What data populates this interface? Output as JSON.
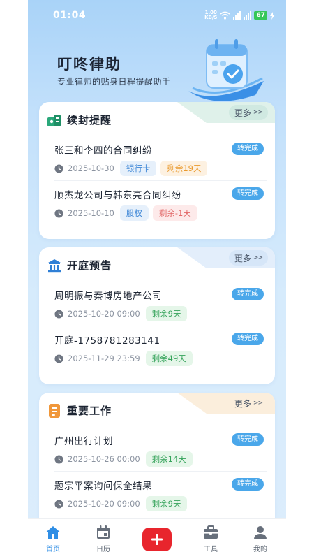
{
  "status_bar": {
    "time": "01:04",
    "net_speed_value": "1.00",
    "net_speed_unit": "KB/S",
    "battery": "67"
  },
  "header": {
    "title": "叮咚律助",
    "subtitle": "专业律师的贴身日程提醒助手"
  },
  "sections": [
    {
      "title": "续封提醒",
      "more_label": "更多",
      "more_arrow": ">>",
      "items": [
        {
          "title": "张三和李四的合同纠纷",
          "date": "2025-10-30",
          "tags": [
            "银行卡",
            "剩余19天"
          ],
          "action": "转完成"
        },
        {
          "title": "顺杰龙公司与韩东亮合同纠纷",
          "date": "2025-10-10",
          "tags": [
            "股权",
            "剩余-1天"
          ],
          "action": "转完成"
        }
      ]
    },
    {
      "title": "开庭预告",
      "more_label": "更多",
      "more_arrow": ">>",
      "items": [
        {
          "title": "周明振与秦博房地产公司",
          "date": "2025-10-20 09:00",
          "tags": [
            "剩余9天"
          ],
          "action": "转完成"
        },
        {
          "title": "开庭-1758781283141",
          "date": "2025-11-29 23:59",
          "tags": [
            "剩余49天"
          ],
          "action": "转完成"
        }
      ]
    },
    {
      "title": "重要工作",
      "more_label": "更多",
      "more_arrow": ">>",
      "items": [
        {
          "title": "广州出行计划",
          "date": "2025-10-26 00:00",
          "tags": [
            "剩余14天"
          ],
          "action": "转完成"
        },
        {
          "title": "题宗平案询问保全结果",
          "date": "2025-10-20 09:00",
          "tags": [
            "剩余9天"
          ],
          "action": "转完成"
        }
      ]
    }
  ],
  "bottom_nav": [
    {
      "label": "首页",
      "icon": "home-icon",
      "active": true
    },
    {
      "label": "日历",
      "icon": "calendar-icon",
      "active": false
    },
    {
      "label": "",
      "icon": "plus-icon",
      "active": false
    },
    {
      "label": "工具",
      "icon": "briefcase-icon",
      "active": false
    },
    {
      "label": "我的",
      "icon": "user-icon",
      "active": false
    }
  ],
  "colors": {
    "accent": "#2f8ee5",
    "complete_button": "#4aa7ea",
    "add_button": "#e8252d",
    "tag_green": "#35a35a",
    "tag_orange": "#ea9a2e",
    "tag_red": "#e26767",
    "tag_blue": "#3d86d6"
  }
}
